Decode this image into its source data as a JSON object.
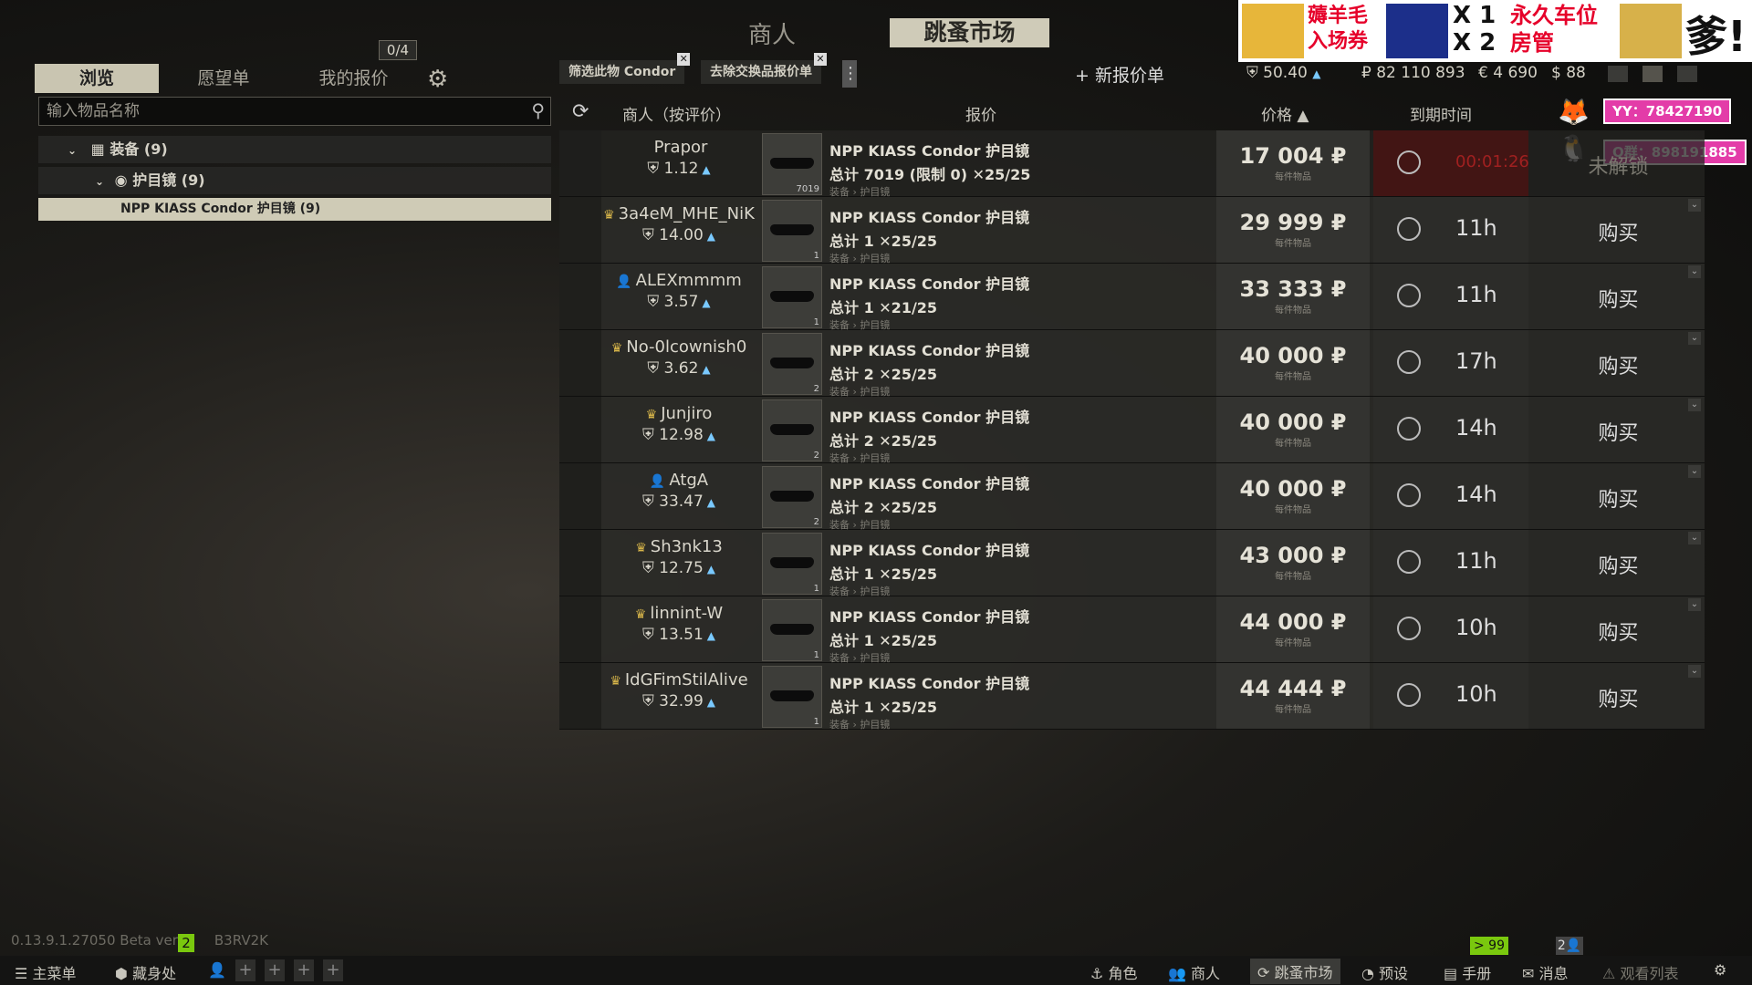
{
  "top_nav": {
    "traders": "商人",
    "flea_market": "跳蚤市场"
  },
  "left_tabs": {
    "browse": "浏览",
    "wishlist": "愿望单",
    "my_offers": "我的报价",
    "offers_count": "0/4"
  },
  "search": {
    "placeholder": "输入物品名称"
  },
  "tree": {
    "category": "装备 (9)",
    "subcategory": "护目镜 (9)",
    "selected_item": "NPP KIASS Condor 护目镜 (9)"
  },
  "filters": {
    "chip1": "筛选此物 Condor",
    "chip2": "去除交换品报价单",
    "new_offer": "+ 新报价单"
  },
  "headers": {
    "trader": "商人（按评价）",
    "offer": "报价",
    "price": "价格 ▲",
    "expires": "到期时间"
  },
  "currencies": {
    "rating": "50.40",
    "rubles": "₽ 82 110 893",
    "euros": "€ 4 690",
    "dollars": "$ 88"
  },
  "ad": {
    "line1": "薅羊毛",
    "line1b": "入场券",
    "x1": "X 1",
    "x2": "X 2",
    "perm": "永久车位",
    "perm2": "房管",
    "big": "爹!",
    "contact1": "YY：78427190",
    "contact2": "Q群：898191885"
  },
  "offers": [
    {
      "seller": "Prapor",
      "rating": "1.12",
      "crown": "",
      "title": "NPP KIASS Condor 护目镜",
      "sub": "总计 7019 (限制 0) ✕25/25",
      "cat": "装备 › 护目镜",
      "count": "7019",
      "price": "17 004 ₽",
      "unit": "每件物品",
      "expires": "00:01:26",
      "action": "未解锁"
    },
    {
      "seller": "3a4eM_MHE_NiK",
      "rating": "14.00",
      "crown": "♛",
      "title": "NPP KIASS Condor 护目镜",
      "sub": "总计 1  ✕25/25",
      "cat": "装备 › 护目镜",
      "count": "1",
      "price": "29 999 ₽",
      "unit": "每件物品",
      "expires": "11h",
      "action": "购买"
    },
    {
      "seller": "ALEXmmmm",
      "rating": "3.57",
      "crown": "👤",
      "title": "NPP KIASS Condor 护目镜",
      "sub": "总计 1  ✕21/25",
      "cat": "装备 › 护目镜",
      "count": "1",
      "price": "33 333 ₽",
      "unit": "每件物品",
      "expires": "11h",
      "action": "购买"
    },
    {
      "seller": "No-0lcownish0",
      "rating": "3.62",
      "crown": "♛",
      "title": "NPP KIASS Condor 护目镜",
      "sub": "总计 2  ✕25/25",
      "cat": "装备 › 护目镜",
      "count": "2",
      "price": "40 000 ₽",
      "unit": "每件物品",
      "expires": "17h",
      "action": "购买"
    },
    {
      "seller": "Junjiro",
      "rating": "12.98",
      "crown": "♛",
      "title": "NPP KIASS Condor 护目镜",
      "sub": "总计 2  ✕25/25",
      "cat": "装备 › 护目镜",
      "count": "2",
      "price": "40 000 ₽",
      "unit": "每件物品",
      "expires": "14h",
      "action": "购买"
    },
    {
      "seller": "AtgA",
      "rating": "33.47",
      "crown": "👤",
      "title": "NPP KIASS Condor 护目镜",
      "sub": "总计 2  ✕25/25",
      "cat": "装备 › 护目镜",
      "count": "2",
      "price": "40 000 ₽",
      "unit": "每件物品",
      "expires": "14h",
      "action": "购买"
    },
    {
      "seller": "Sh3nk13",
      "rating": "12.75",
      "crown": "♛",
      "title": "NPP KIASS Condor 护目镜",
      "sub": "总计 1  ✕25/25",
      "cat": "装备 › 护目镜",
      "count": "1",
      "price": "43 000 ₽",
      "unit": "每件物品",
      "expires": "11h",
      "action": "购买"
    },
    {
      "seller": "linnint-W",
      "rating": "13.51",
      "crown": "♛",
      "title": "NPP KIASS Condor 护目镜",
      "sub": "总计 1  ✕25/25",
      "cat": "装备 › 护目镜",
      "count": "1",
      "price": "44 000 ₽",
      "unit": "每件物品",
      "expires": "10h",
      "action": "购买"
    },
    {
      "seller": "IdGFimStilAlive",
      "rating": "32.99",
      "crown": "♛",
      "title": "NPP KIASS Condor 护目镜",
      "sub": "总计 1  ✕25/25",
      "cat": "装备 › 护目镜",
      "count": "1",
      "price": "44 444 ₽",
      "unit": "每件物品",
      "expires": "10h",
      "action": "购买"
    }
  ],
  "footer": {
    "version": "0.13.9.1.27050 Beta versi",
    "version_badge": "2",
    "version_tail": "B3RV2K",
    "main_menu": "主菜单",
    "hideout": "藏身处",
    "character": "角色",
    "traders": "商人",
    "flea": "跳蚤市场",
    "presets": "预设",
    "handbook": "手册",
    "messages": "消息",
    "watchlist": "观看列表",
    "msg_badge": "> 99",
    "friends_badge": "2👤"
  }
}
